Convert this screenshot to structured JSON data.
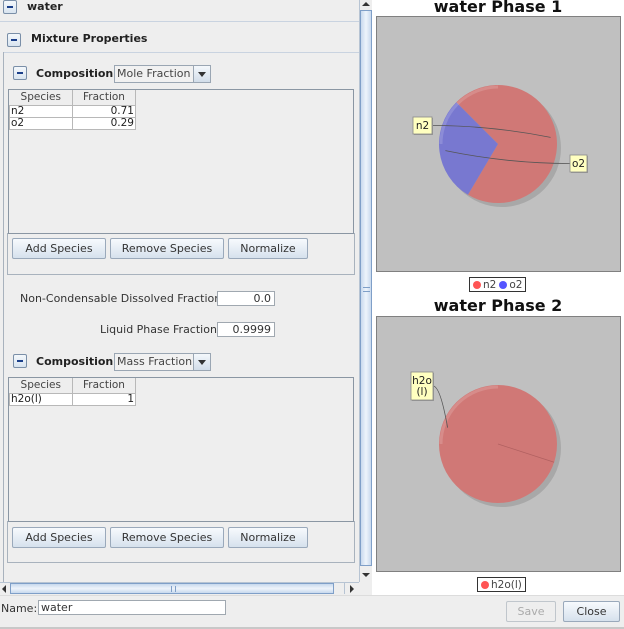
{
  "header": {
    "title": "water",
    "mixture_section": "Mixture Properties"
  },
  "composition1": {
    "label": "Composition",
    "basis": "Mole Fraction",
    "columns": [
      "Species",
      "Fraction"
    ],
    "rows": [
      {
        "species": "n2",
        "fraction": "0.71"
      },
      {
        "species": "o2",
        "fraction": "0.29"
      }
    ],
    "buttons": {
      "add": "Add Species",
      "remove": "Remove Species",
      "normalize": "Normalize"
    }
  },
  "fields": {
    "non_condensable_label": "Non-Condensable Dissolved Fraction",
    "non_condensable_value": "0.0",
    "liquid_phase_label": "Liquid Phase Fraction",
    "liquid_phase_value": "0.9999"
  },
  "composition2": {
    "label": "Composition",
    "basis": "Mass Fraction",
    "columns": [
      "Species",
      "Fraction"
    ],
    "rows": [
      {
        "species": "h2o(l)",
        "fraction": "1"
      }
    ],
    "buttons": {
      "add": "Add Species",
      "remove": "Remove Species",
      "normalize": "Normalize"
    }
  },
  "footer": {
    "name_label": "Name:",
    "name_value": "water",
    "save_label": "Save",
    "close_label": "Close"
  },
  "colors": {
    "n2": "#d07876",
    "o2": "#7878d0",
    "h2o": "#d07876",
    "plot_bg": "#c0c0c0",
    "legend_red": "#ff5555",
    "legend_blue": "#5555ff",
    "label_bg": "#ffffc0"
  },
  "chart_data": [
    {
      "type": "pie",
      "title": "water Phase 1",
      "categories": [
        "n2",
        "o2"
      ],
      "values": [
        0.71,
        0.29
      ],
      "legend": [
        "n2",
        "o2"
      ],
      "legend_position": "bottom"
    },
    {
      "type": "pie",
      "title": "water Phase 2",
      "categories": [
        "h2o(l)"
      ],
      "values": [
        1
      ],
      "legend": [
        "h2o(l)"
      ],
      "legend_position": "bottom"
    }
  ]
}
